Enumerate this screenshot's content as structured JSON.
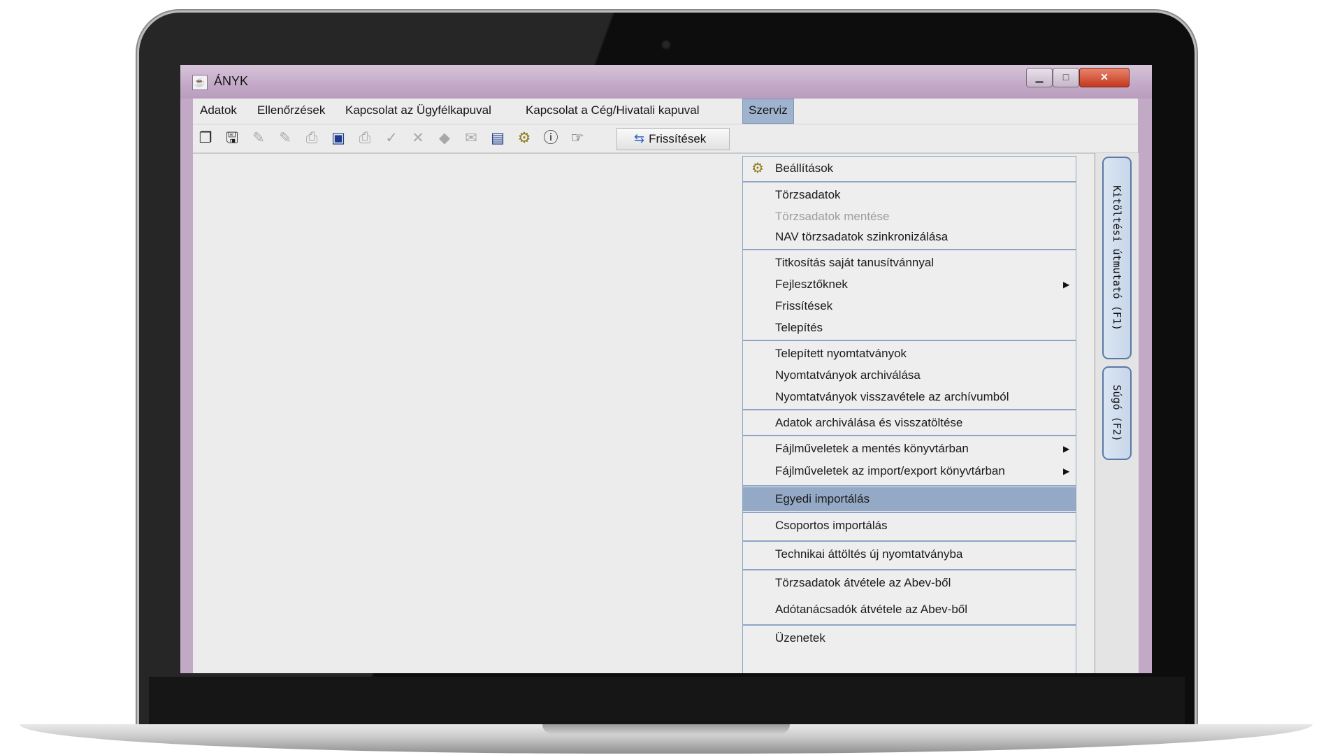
{
  "window": {
    "title": "ÁNYK"
  },
  "menubar": {
    "items": [
      {
        "label": "Adatok"
      },
      {
        "label": "Ellenőrzések"
      },
      {
        "label": "Kapcsolat az Ügyfélkapuval"
      },
      {
        "label": "Kapcsolat a Cég/Hivatali kapuval"
      },
      {
        "label": "Szerviz",
        "active": true
      }
    ]
  },
  "toolbar": {
    "icons": [
      "new-form-icon",
      "save-icon",
      "edit-disabled-icon",
      "edit2-disabled-icon",
      "print-preview-disabled-icon",
      "tree-icon",
      "print-disabled-icon",
      "check-disabled-icon",
      "delete-disabled-icon",
      "stamp-disabled-icon",
      "envelope-disabled-icon",
      "calculator-icon",
      "settings-icon",
      "info-icon",
      "pointer-icon"
    ],
    "refresh_label": "Frissítések"
  },
  "side_tabs": {
    "guide": "Kitöltési útmutató (F1)",
    "help": "Súgó (F2)"
  },
  "service_menu": {
    "items": [
      {
        "label": "Beállítások",
        "icon": "gear-icon"
      },
      {
        "label": "Törzsadatok"
      },
      {
        "label": "Törzsadatok mentése",
        "disabled": true
      },
      {
        "label": "NAV törzsadatok szinkronizálása"
      },
      {
        "label": "Titkosítás saját tanusítvánnyal"
      },
      {
        "label": "Fejlesztőknek",
        "submenu": true
      },
      {
        "label": "Frissítések"
      },
      {
        "label": "Telepítés"
      },
      {
        "label": "Telepített nyomtatványok"
      },
      {
        "label": "Nyomtatványok archiválása"
      },
      {
        "label": "Nyomtatványok visszavétele az archívumból"
      },
      {
        "label": "Adatok archiválása és visszatöltése"
      },
      {
        "label": "Fájlműveletek a mentés könyvtárban",
        "submenu": true
      },
      {
        "label": "Fájlműveletek az import/export könyvtárban",
        "submenu": true
      },
      {
        "label": "Egyedi importálás",
        "highlighted": true
      },
      {
        "label": "Csoportos importálás"
      },
      {
        "label": "Technikai áttöltés új nyomtatványba"
      },
      {
        "label": "Törzsadatok átvétele az Abev-ből"
      },
      {
        "label": "Adótanácsadók átvétele az Abev-ből"
      },
      {
        "label": "Üzenetek"
      }
    ]
  },
  "colors": {
    "menu_highlight": "#93a9c6",
    "titlebar": "#c3a9c7",
    "separator": "#8ea4c6"
  }
}
